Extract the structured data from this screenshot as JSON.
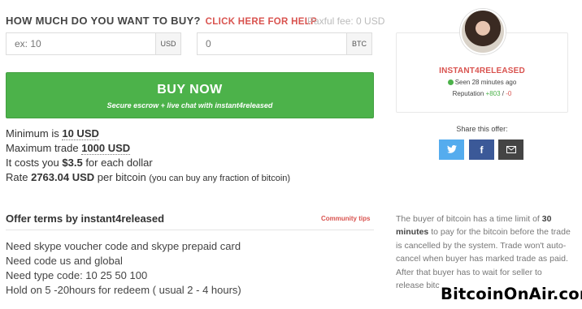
{
  "buy_section": {
    "heading": "HOW MUCH DO YOU WANT TO BUY?",
    "help_link": "CLICK HERE FOR HELP",
    "fee": "Paxful fee: 0 USD",
    "usd_input": {
      "placeholder": "ex: 10",
      "value": "",
      "currency": "USD"
    },
    "btc_input": {
      "placeholder": "0",
      "value": "",
      "currency": "BTC"
    },
    "button": {
      "label": "BUY NOW",
      "sublabel": "Secure escrow + live chat with instant4released"
    }
  },
  "limits": {
    "minimum_prefix": "Minimum is",
    "minimum_value": "10 USD",
    "maximum_prefix": "Maximum trade",
    "maximum_value": "1000 USD",
    "cost_prefix": "It costs you",
    "cost_value": "$3.5",
    "cost_suffix": "for each dollar",
    "rate_prefix": "Rate",
    "rate_value": "2763.04 USD",
    "rate_suffix": "per bitcoin",
    "rate_note": "(you can buy any fraction of bitcoin)"
  },
  "terms": {
    "title": "Offer terms by instant4released",
    "community_tips": "Community tips",
    "lines": [
      "Need skype voucher code and skype prepaid card",
      "Need code us and global",
      "Need type code: 10 25 50 100",
      "Hold on 5 -20hours for redeem ( usual 2 - 4 hours)"
    ]
  },
  "seller": {
    "name": "INSTANT4RELEASED",
    "seen": "Seen 28 minutes ago",
    "reputation_label": "Reputation",
    "reputation_positive": "+803",
    "reputation_separator": "/",
    "reputation_negative": "-0",
    "status_color": "#4cb24a"
  },
  "share": {
    "label": "Share this offer:",
    "buttons": [
      {
        "icon": "twitter-icon",
        "glyph": "🐦"
      },
      {
        "icon": "facebook-icon",
        "glyph": "f"
      },
      {
        "icon": "email-icon",
        "glyph": "✉"
      }
    ]
  },
  "sidebar_note": {
    "part1": "The buyer of bitcoin has a time limit of",
    "bold": "30 minutes",
    "part2": "to pay for the bitcoin before the trade is cancelled by the system. Trade won't auto-cancel when buyer has marked trade as paid. After that buyer has to wait for seller to release bitc"
  },
  "watermark": "BitcoinOnAir.com",
  "colors": {
    "accent_red": "#d9534f",
    "buy_green": "#4cb24a",
    "twitter": "#55acee",
    "facebook": "#3b5998",
    "email": "#444444"
  }
}
